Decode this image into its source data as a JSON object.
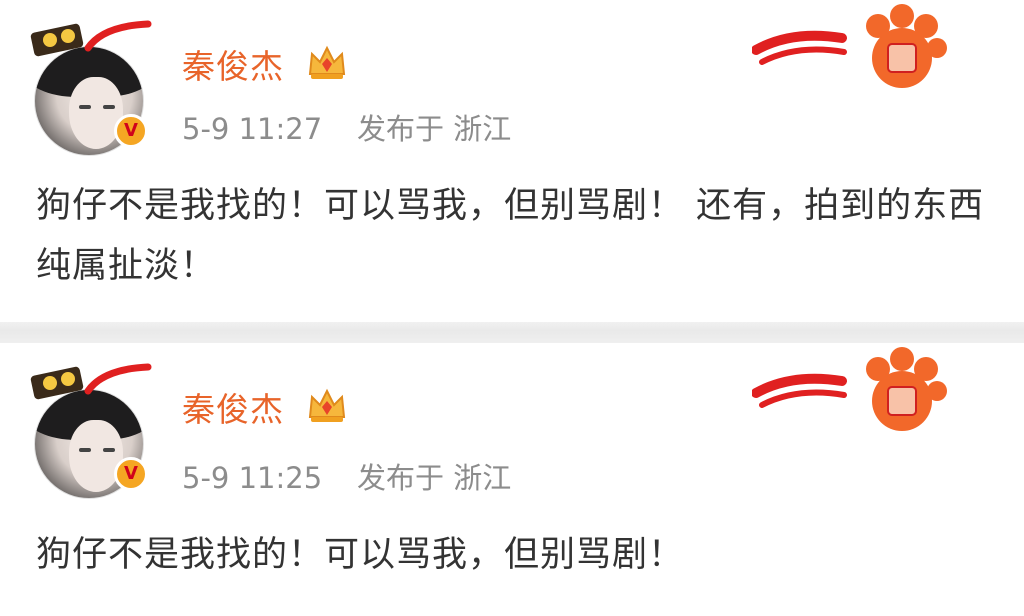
{
  "posts": [
    {
      "username": "秦俊杰",
      "time": "5-9 11:27",
      "location": "发布于 浙江",
      "content": "狗仔不是我找的！可以骂我，但别骂剧！ 还有，拍到的东西纯属扯淡！"
    },
    {
      "username": "秦俊杰",
      "time": "5-9 11:25",
      "location": "发布于 浙江",
      "content": "狗仔不是我找的！可以骂我，但别骂剧！"
    }
  ],
  "colors": {
    "username": "#e8642a",
    "meta": "#8c8c8c",
    "text": "#333333",
    "separator": "#eeeeee",
    "verified_badge": "#f5a623"
  },
  "icons": [
    "tiger-sticker-icon",
    "crown-icon",
    "verified-icon",
    "tiger-paw-decoration-icon"
  ]
}
